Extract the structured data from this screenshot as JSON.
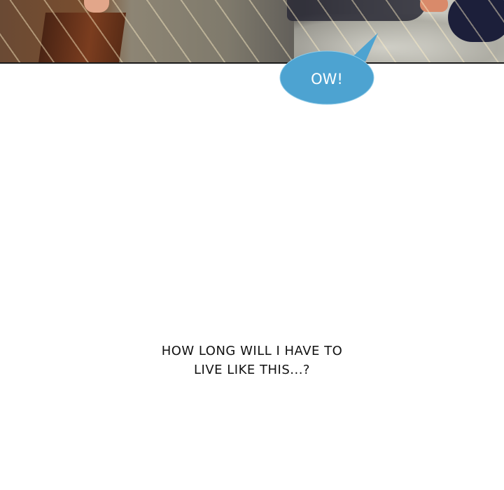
{
  "bubble": {
    "text": "OW!",
    "color": "#4da3d1"
  },
  "caption": {
    "line1": "HOW LONG WILL I HAVE TO",
    "line2": "LIVE LIKE THIS...?"
  }
}
